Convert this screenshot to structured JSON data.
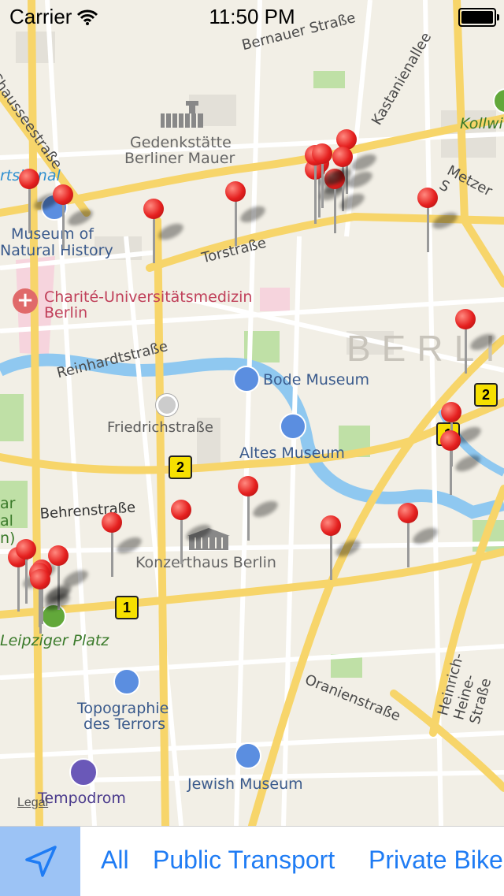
{
  "status_bar": {
    "carrier": "Carrier",
    "time": "11:50 PM"
  },
  "map": {
    "streets": [
      "Bernauer Straße",
      "Kastanienallee",
      "Chausseestraße",
      "Torstraße",
      "Reinhardtstraße",
      "Friedrichstraße",
      "Behrenstraße",
      "Oranienstraße",
      "Heinrich-Heine-Straße",
      "Metzer S"
    ],
    "pois": [
      "Gedenkstätte",
      "Berliner Mauer",
      "Museum of",
      "Natural History",
      "Charité-Universitätsmedizin",
      "Berlin",
      "Bode Museum",
      "Altes Museum",
      "Konzerthaus Berlin",
      "Topographie",
      "des Terrors",
      "Jewish Museum",
      "Tempodrom",
      "Leipziger Platz",
      "Kollwi",
      "rtskanal",
      "ar",
      "al",
      "n)"
    ],
    "city_label": "BERLI",
    "transit_badges": [
      "2",
      "2",
      "1",
      "1"
    ],
    "pins_count": 26,
    "legal": "Legal"
  },
  "toolbar": {
    "locate_icon": "location-arrow-icon",
    "filters": [
      "All",
      "Public Transport",
      "Private Bike"
    ]
  },
  "colors": {
    "accent": "#1f7cf4",
    "pin": "#e5201f",
    "road_major": "#f7d56a",
    "water": "#8fc8f0",
    "park": "#b9dea0"
  }
}
